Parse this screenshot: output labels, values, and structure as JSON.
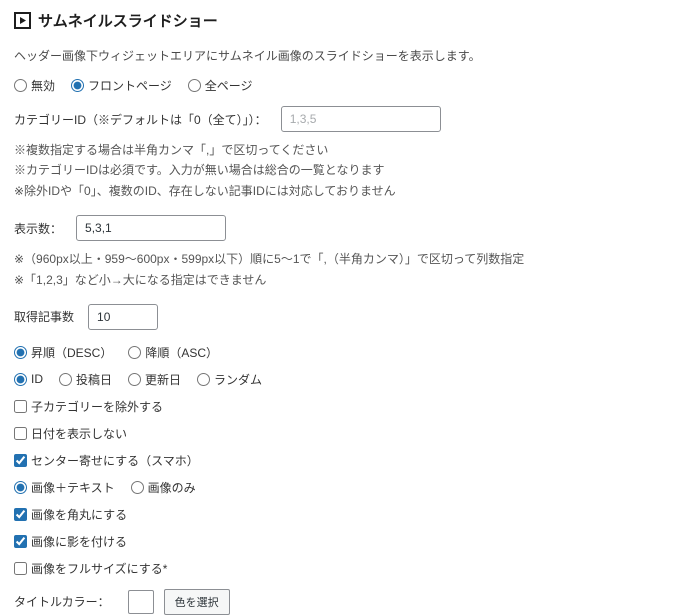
{
  "title": "サムネイルスライドショー",
  "icon": "slideshow-icon",
  "description": "ヘッダー画像下ウィジェットエリアにサムネイル画像のスライドショーを表示します。",
  "scope_options": {
    "disabled": "無効",
    "front": "フロントページ",
    "all": "全ページ",
    "selected": "front"
  },
  "category": {
    "label": "カテゴリーID（※デフォルトは「0（全て）」）：",
    "placeholder": "1,3,5",
    "value": "",
    "notes": "※複数指定する場合は半角カンマ「,」で区切ってください\n※カテゴリーIDは必須です。入力が無い場合は総合の一覧となります\n※除外IDや「0」、複数のID、存在しない記事IDには対応しておりません"
  },
  "display_count": {
    "label": "表示数：",
    "value": "5,3,1",
    "notes": "※（960px以上・959～600px・599px以下）順に5～1で「,（半角カンマ）」で区切って列数指定\n※「1,2,3」など小→大になる指定はできません"
  },
  "fetch_count": {
    "label": "取得記事数",
    "value": "10"
  },
  "order_dir": {
    "desc": "昇順（DESC）",
    "asc": "降順（ASC）",
    "selected": "desc"
  },
  "order_by": {
    "id": "ID",
    "posted": "投稿日",
    "modified": "更新日",
    "random": "ランダム",
    "selected": "id"
  },
  "checks": {
    "exclude_children": {
      "label": "子カテゴリーを除外する",
      "checked": false
    },
    "hide_date": {
      "label": "日付を表示しない",
      "checked": false
    },
    "center_sp": {
      "label": "センター寄せにする（スマホ）",
      "checked": true
    },
    "rounded": {
      "label": "画像を角丸にする",
      "checked": true
    },
    "shadow": {
      "label": "画像に影を付ける",
      "checked": true
    },
    "fullsize": {
      "label": "画像をフルサイズにする*",
      "checked": false
    }
  },
  "image_mode": {
    "with_text": "画像＋テキスト",
    "image_only": "画像のみ",
    "selected": "with_text"
  },
  "title_color": {
    "label": "タイトルカラー：",
    "button": "色を選択",
    "value": "#ffffff"
  }
}
